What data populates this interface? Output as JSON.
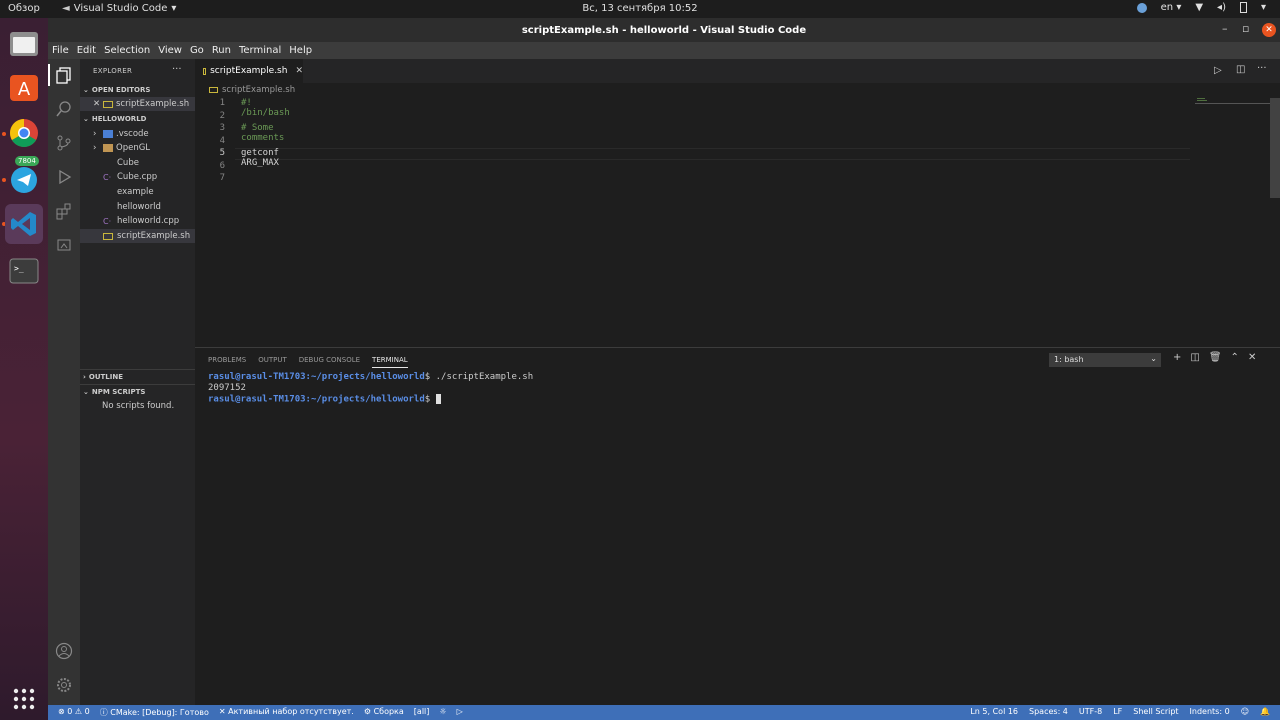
{
  "topbar": {
    "overview": "Обзор",
    "app_name": "Visual Studio Code",
    "clock": "Вс, 13 сентября  10:52",
    "lang": "en"
  },
  "dock": {
    "telegram_badge": "7804"
  },
  "window": {
    "title": "scriptExample.sh - helloworld - Visual Studio Code"
  },
  "menu": [
    "File",
    "Edit",
    "Selection",
    "View",
    "Go",
    "Run",
    "Terminal",
    "Help"
  ],
  "sidebar": {
    "header": "EXPLORER",
    "open_editors": "OPEN EDITORS",
    "open_file": "scriptExample.sh",
    "project": "HELLOWORLD",
    "items": [
      {
        "label": ".vscode",
        "kind": "folder"
      },
      {
        "label": "OpenGL",
        "kind": "folder"
      },
      {
        "label": "Cube",
        "kind": "file"
      },
      {
        "label": "Cube.cpp",
        "kind": "cpp"
      },
      {
        "label": "example",
        "kind": "file"
      },
      {
        "label": "helloworld",
        "kind": "file"
      },
      {
        "label": "helloworld.cpp",
        "kind": "cpp"
      },
      {
        "label": "scriptExample.sh",
        "kind": "sh"
      }
    ],
    "outline": "OUTLINE",
    "npm": "NPM SCRIPTS",
    "npm_empty": "No scripts found."
  },
  "editor": {
    "tab": "scriptExample.sh",
    "breadcrumb": "scriptExample.sh",
    "lines": [
      {
        "n": "1",
        "text": "#! /bin/bash",
        "color": "#6a9955"
      },
      {
        "n": "2",
        "text": "",
        "color": "#d4d4d4"
      },
      {
        "n": "3",
        "text": "# Some comments",
        "color": "#6a9955"
      },
      {
        "n": "4",
        "text": "",
        "color": "#d4d4d4"
      },
      {
        "n": "5",
        "text": "getconf ARG_MAX",
        "color": "#d4d4d4"
      },
      {
        "n": "6",
        "text": "",
        "color": "#d4d4d4"
      },
      {
        "n": "7",
        "text": "",
        "color": "#d4d4d4"
      }
    ]
  },
  "panel": {
    "tabs": [
      "PROBLEMS",
      "OUTPUT",
      "DEBUG CONSOLE",
      "TERMINAL"
    ],
    "shell": "1: bash",
    "terminal": {
      "user1": "rasul@rasul-TM1703",
      "path1": ":~/projects/helloworld",
      "cmd1": "$ ./scriptExample.sh",
      "output": "2097152",
      "user2": "rasul@rasul-TM1703",
      "path2": ":~/projects/helloworld",
      "cmd2": "$ "
    }
  },
  "status": {
    "errors": "⊗ 0 ⚠ 0",
    "cmake": "CMake: [Debug]: Готово",
    "kit": "Активный набор отсутствует.",
    "build": "Сборка",
    "target": "[all]",
    "position": "Ln 5, Col 16",
    "spaces": "Spaces: 4",
    "encoding": "UTF-8",
    "eol": "LF",
    "language": "Shell Script",
    "indents": "Indents: 0"
  },
  "colors": {
    "accent": "#3e6fb8",
    "ubuntu_orange": "#e95420"
  }
}
